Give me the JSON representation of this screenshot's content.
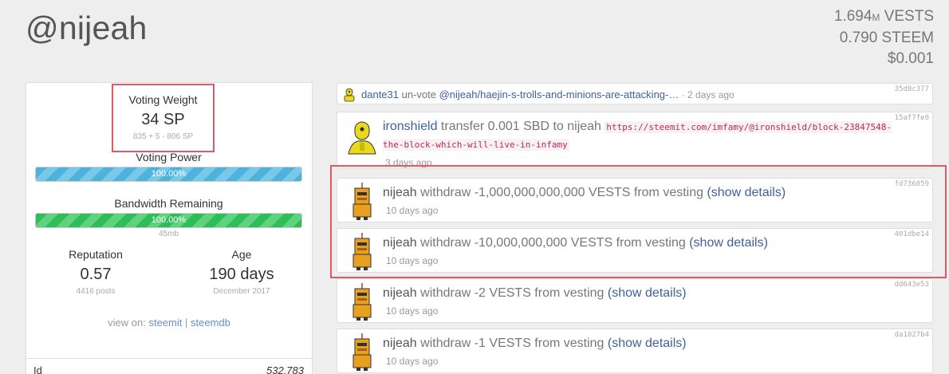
{
  "header": {
    "username": "@nijeah",
    "vests": "1.694",
    "vests_unit_m": "M",
    "vests_unit": " VESTS",
    "steem": "0.790 STEEM",
    "usd": "$0.001"
  },
  "account": {
    "voting_weight_title": "Voting Weight",
    "voting_weight_value": "34 SP",
    "voting_weight_sub": "835 + 5 - 806 SP",
    "voting_power_title": "Voting Power",
    "voting_power_text": "100.00%",
    "voting_power_fraction": 1.0,
    "bandwidth_title": "Bandwidth Remaining",
    "bandwidth_text": "100.00%",
    "bandwidth_fraction": 1.0,
    "bandwidth_sub": "45mb",
    "reputation_title": "Reputation",
    "reputation_value": "0.57",
    "reputation_sub": "4416 posts",
    "age_title": "Age",
    "age_value": "190 days",
    "age_sub": "December 2017",
    "view_on_label": "view on:",
    "view_on_steemit": "steemit",
    "view_on_sep": "|",
    "view_on_steemdb": "steemdb",
    "id_label": "Id",
    "id_value": "532,783"
  },
  "ops": [
    {
      "actor": "dante31",
      "action": " un-vote ",
      "target": "@nijeah/haejin-s-trolls-and-minions-are-attacking-…",
      "time": " · 2 days ago",
      "hash": "35d8c377",
      "avatar_icon": "yellow-robot-icon"
    },
    {
      "actor": "ironshield",
      "action": " transfer 0.001 SBD to nijeah ",
      "url": "https://steemit.com/imfamy/@ironshield/block-23847548-the-block-which-will-live-in-infamy",
      "time": "3 days ago",
      "hash": "15af7fe0",
      "avatar_icon": "yellow-robot-icon"
    },
    {
      "actor": "nijeah",
      "action": " withdraw -1,000,000,000,000 VESTS from vesting ",
      "details": "(show details)",
      "time": "10 days ago",
      "hash": "fd736859",
      "avatar_icon": "orange-robot-icon"
    },
    {
      "actor": "nijeah",
      "action": " withdraw -10,000,000,000 VESTS from vesting ",
      "details": "(show details)",
      "time": "10 days ago",
      "hash": "401dbe14",
      "avatar_icon": "orange-robot-icon"
    },
    {
      "actor": "nijeah",
      "action": " withdraw -2 VESTS from vesting ",
      "details": "(show details)",
      "time": "10 days ago",
      "hash": "dd643e53",
      "avatar_icon": "orange-robot-icon"
    },
    {
      "actor": "nijeah",
      "action": " withdraw -1 VESTS from vesting ",
      "details": "(show details)",
      "time": "10 days ago",
      "hash": "da1027b4",
      "avatar_icon": "orange-robot-icon"
    }
  ],
  "colors": {
    "accent_link": "#4060a0",
    "highlight": "#e05a63",
    "bar_blue": "#4db3dc",
    "bar_green": "#2ebd56"
  }
}
